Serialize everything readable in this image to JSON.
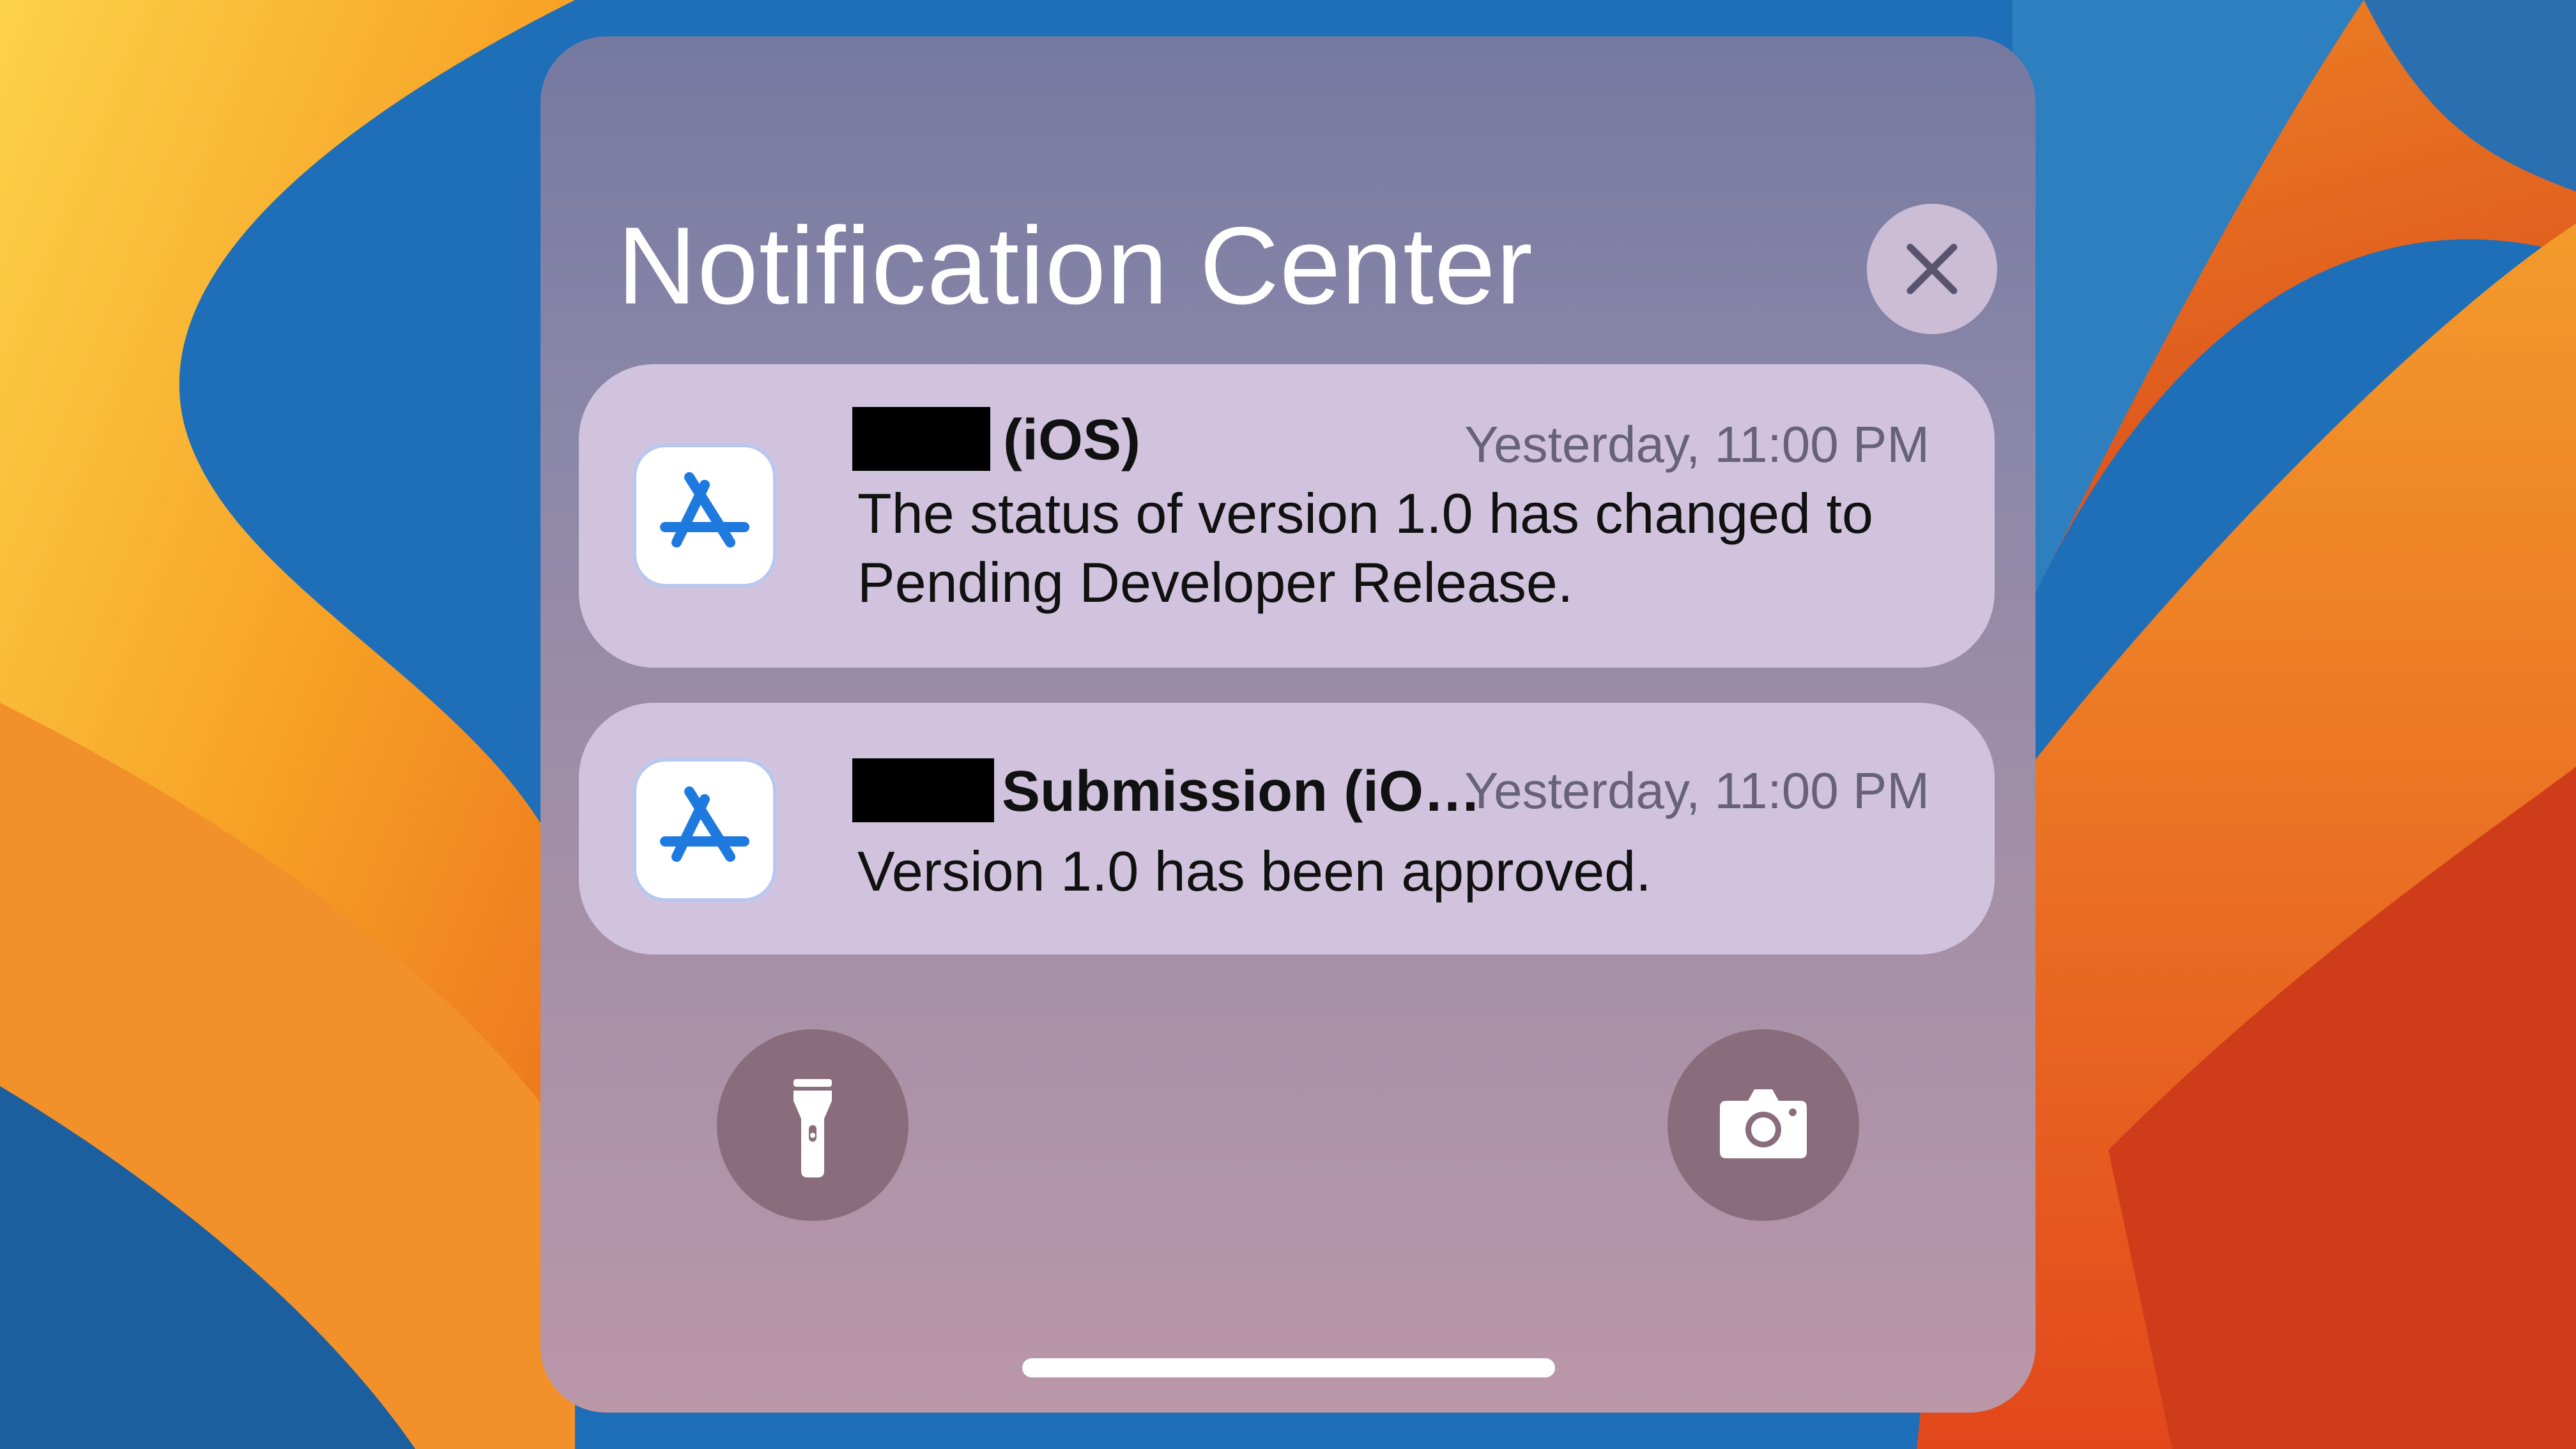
{
  "notification_center": {
    "title": "Notification Center",
    "close_icon": "close-icon"
  },
  "notifications": [
    {
      "app_icon": "app-store-connect-icon",
      "title_redacted": true,
      "title": "(iOS)",
      "time": "Yesterday, 11:00 PM",
      "body": "The status of version 1.0 has changed to Pending Developer Release."
    },
    {
      "app_icon": "app-store-connect-icon",
      "title_redacted": true,
      "title": "Submission (iO…",
      "time": "Yesterday, 11:00 PM",
      "body": "Version 1.0 has been approved."
    }
  ],
  "quick_actions": {
    "left_icon": "flashlight-icon",
    "right_icon": "camera-icon"
  },
  "colors": {
    "panel_top": "#7679a0",
    "panel_bottom": "#bb97a8",
    "card_background": "#d1c3de",
    "app_icon_blue": "#1f7ae0",
    "wallpaper_orange": "#f59a1e",
    "wallpaper_blue": "#1f6fb8"
  }
}
